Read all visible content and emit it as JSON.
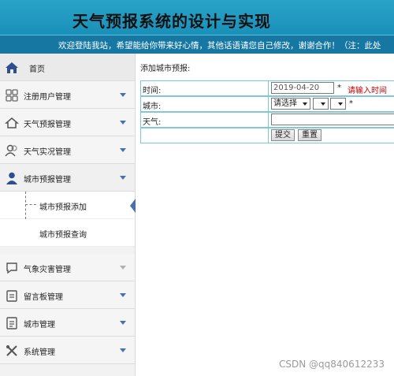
{
  "header": {
    "title": "天气预报系统的设计与实现",
    "marquee": "欢迎登陆我站，希望能给你带来好心情，其他话语请您自己修改，谢谢合作！（注：此处"
  },
  "sidebar": {
    "home": "首页",
    "items": [
      {
        "label": "注册用户管理",
        "icon": "grid-icon"
      },
      {
        "label": "天气预报管理",
        "icon": "house-icon"
      },
      {
        "label": "天气实况管理",
        "icon": "users-icon"
      },
      {
        "label": "城市预报管理",
        "icon": "user-icon"
      },
      {
        "label": "气象灾害管理",
        "icon": "chat-bubble-icon"
      },
      {
        "label": "留言板管理",
        "icon": "clipboard-icon"
      },
      {
        "label": "城市管理",
        "icon": "document-icon"
      },
      {
        "label": "系统管理",
        "icon": "tools-icon"
      }
    ],
    "submenu": [
      "城市预报添加",
      "城市预报查询"
    ]
  },
  "main": {
    "breadcrumb": "添加城市预报:",
    "form": {
      "time_label": "时间:",
      "time_value": "2019-04-20",
      "time_hint": "请输入时间",
      "city_label": "城市:",
      "city_select": "请选择",
      "required": "*",
      "weather_label": "天气:",
      "submit": "提交",
      "reset": "重置"
    }
  },
  "watermark": "CSDN @qq840612233",
  "colors": {
    "header": "#1990b8",
    "marquee_bar": "#1677a3",
    "accent": "#4a6fb0",
    "hint": "#cc0000"
  }
}
